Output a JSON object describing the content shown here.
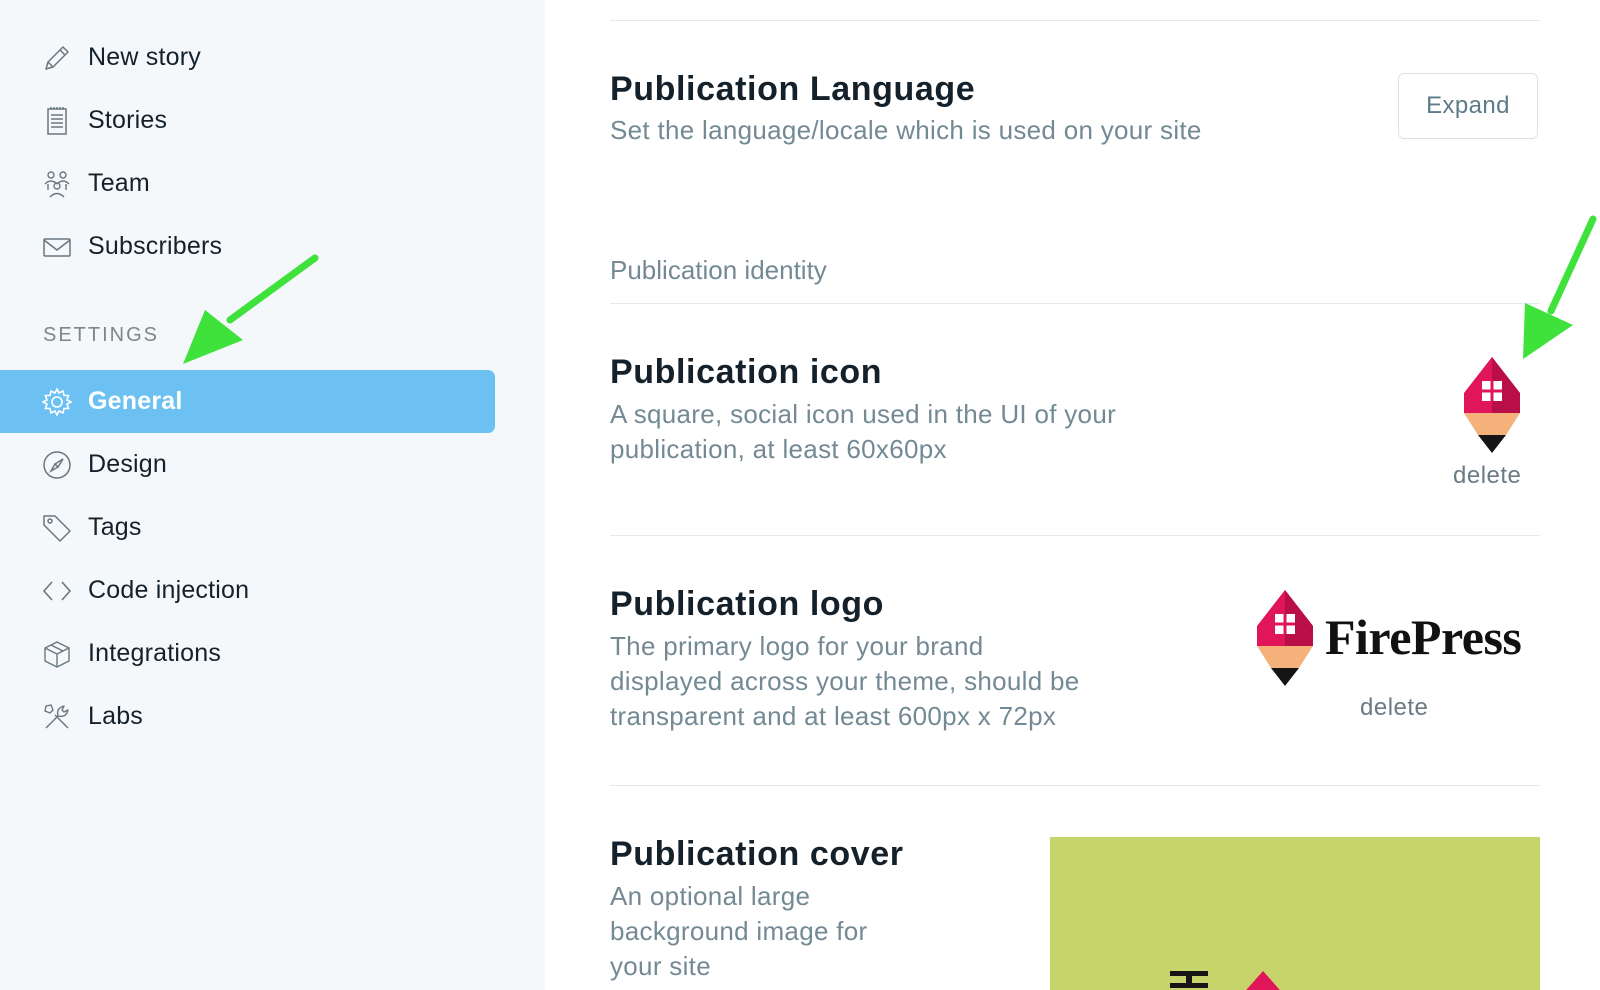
{
  "sidebar": {
    "items": [
      {
        "label": "New story"
      },
      {
        "label": "Stories"
      },
      {
        "label": "Team"
      },
      {
        "label": "Subscribers"
      }
    ],
    "settings_heading": "SETTINGS",
    "settings_items": [
      {
        "label": "General",
        "active": true
      },
      {
        "label": "Design"
      },
      {
        "label": "Tags"
      },
      {
        "label": "Code injection"
      },
      {
        "label": "Integrations"
      },
      {
        "label": "Labs"
      }
    ]
  },
  "main": {
    "language": {
      "title": "Publication Language",
      "description": "Set the language/locale which is used on your site",
      "expand_label": "Expand"
    },
    "identity_heading": "Publication identity",
    "icon_setting": {
      "title": "Publication icon",
      "description_line1": "A square, social icon used in the UI of your",
      "description_line2": "publication, at least 60x60px",
      "delete_label": "delete"
    },
    "logo_setting": {
      "title": "Publication logo",
      "description_line1": "The primary logo for your brand",
      "description_line2": "displayed across your theme, should be",
      "description_line3": "transparent and at least 600px x 72px",
      "brand_text": "FirePress",
      "delete_label": "delete"
    },
    "cover_setting": {
      "title": "Publication cover",
      "description_line1": "An optional large",
      "description_line2": "background image for",
      "description_line3": "your site"
    }
  },
  "colors": {
    "active_nav": "#6cc0f2",
    "sidebar_bg": "#f4f8fb",
    "arrow": "#3ee23a",
    "cover_bg": "#c7d46b",
    "icon_pink": "#e0155a"
  },
  "icons": [
    "pencil-icon",
    "stories-icon",
    "team-icon",
    "envelope-icon",
    "gear-icon",
    "compass-icon",
    "tag-icon",
    "code-icon",
    "box-icon",
    "tools-icon"
  ]
}
